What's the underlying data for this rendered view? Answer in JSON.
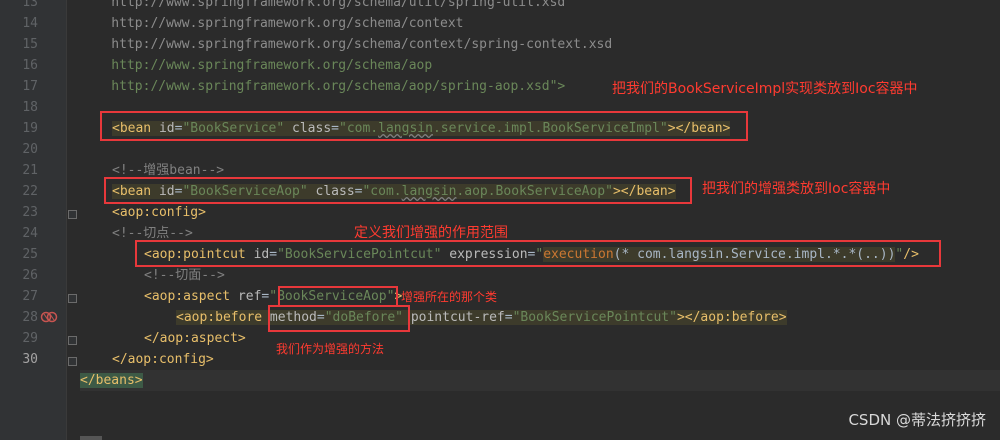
{
  "editor": {
    "line_numbers": [
      "13",
      "14",
      "15",
      "16",
      "17",
      "18",
      "19",
      "20",
      "21",
      "22",
      "23",
      "24",
      "25",
      "26",
      "27",
      "28",
      "29",
      "30"
    ],
    "top_partial": "    http://www.springframework.org/schema/util/spring-util.xsd",
    "lines": {
      "l13": "    http://www.springframework.org/schema/context",
      "l14": "    http://www.springframework.org/schema/context/spring-context.xsd",
      "l15": "    http://www.springframework.org/schema/aop",
      "l16": "    http://www.springframework.org/schema/aop/spring-aop.xsd\">",
      "l20_comment": "<!--增强bean-->",
      "l25_comment": "<!--切面-->",
      "l23_comment": "<!--切点-->"
    },
    "bean1": {
      "open": "<bean",
      "id_attr": "id",
      "id_val": "\"BookService\"",
      "class_attr": "class",
      "class_val_a": "\"com.",
      "class_val_b": "langsin",
      "class_val_c": ".service.impl.BookServiceImpl\"",
      "close": "></bean>"
    },
    "bean2": {
      "open": "<bean",
      "id_attr": "id",
      "id_val": "\"BookServiceAop\"",
      "class_attr": "class",
      "class_val_a": "\"com.",
      "class_val_b": "langsin",
      "class_val_c": ".aop.BookServiceAop\"",
      "close": "></bean>"
    },
    "aop_config_open": "<aop:config>",
    "pointcut": {
      "open": "<aop:pointcut",
      "id_attr": "id",
      "id_val": "\"BookServicePointcut\"",
      "expr_attr": "expression",
      "expr_val_a": "\"",
      "expr_exec": "execution",
      "expr_val_b": "(* com.langsin.Service.impl.*.*(..))",
      "expr_val_c": "\"",
      "close": "/>"
    },
    "aspect": {
      "open": "<aop:aspect",
      "ref_attr": "ref",
      "ref_val_a": "\"",
      "ref_val_b": "BookServiceAop",
      "ref_val_c": "\"",
      "close": ">"
    },
    "before": {
      "open": "<aop:before",
      "method_attr": "method",
      "method_val": "\"doBefore\"",
      "pref_attr": "pointcut-ref",
      "pref_val": "\"BookServicePointcut\"",
      "close": "></aop:before>"
    },
    "aspect_close": "</aop:aspect>",
    "config_close": "</aop:config>",
    "beans_close": "</beans>"
  },
  "annotations": {
    "a1": "把我们的BookServiceImpl实现类放到Ioc容器中",
    "a2": "把我们的增强类放到Ioc容器中",
    "a3": "定义我们增强的作用范围",
    "a4": "增强所在的那个类",
    "a5": "我们作为增强的方法"
  },
  "watermark": "CSDN @蒂法挤挤挤"
}
